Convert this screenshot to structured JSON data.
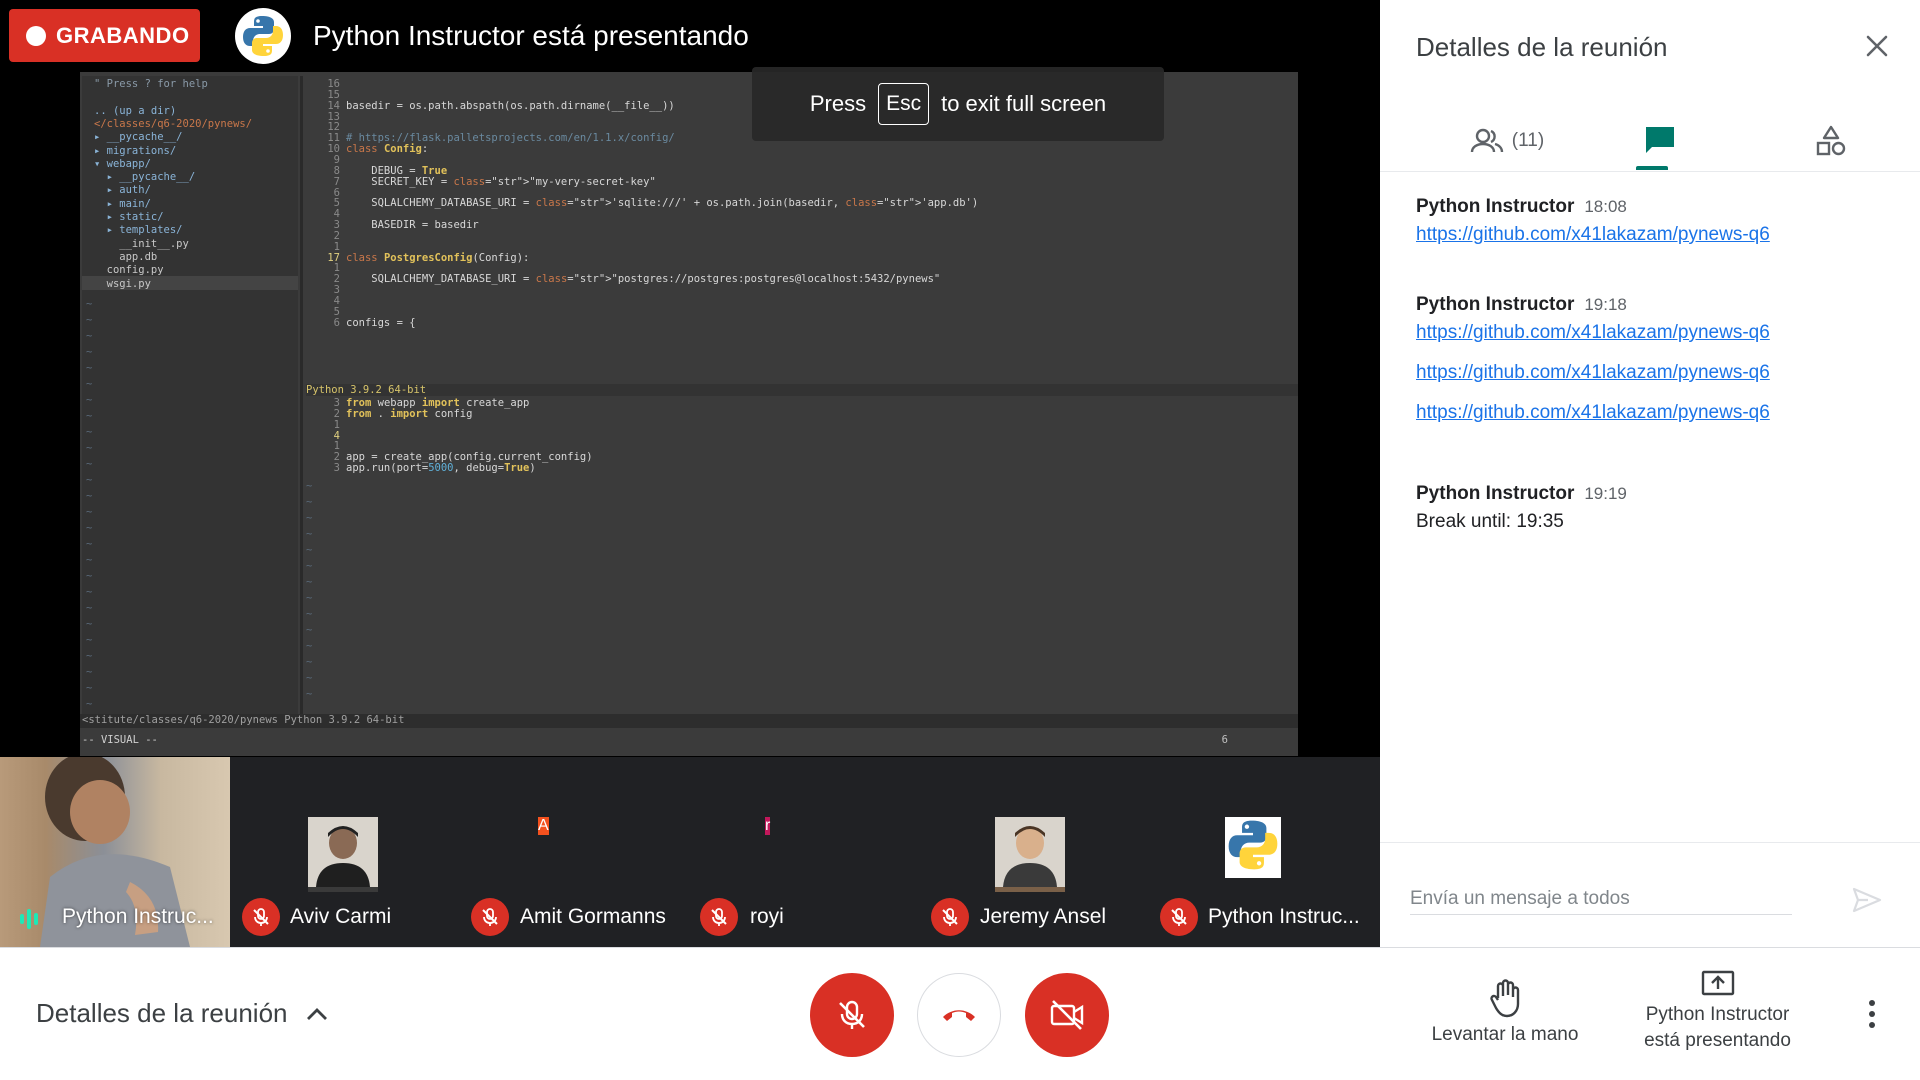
{
  "recording": {
    "label": "GRABANDO"
  },
  "presenter": {
    "title": "Python Instructor está presentando"
  },
  "fullscreen_toast": {
    "before": "Press",
    "key": "Esc",
    "after": "to exit full screen"
  },
  "vim": {
    "tree": [
      "\" Press ? for help",
      "",
      ".. (up a dir)",
      "</classes/q6-2020/pynews/",
      "▸ __pycache__/",
      "▸ migrations/",
      "▾ webapp/",
      "  ▸ __pycache__/",
      "  ▸ auth/",
      "  ▸ main/",
      "  ▸ static/",
      "  ▸ templates/",
      "    __init__.py",
      "    app.db",
      "  config.py",
      "  wsgi.py"
    ],
    "code_top": [
      {
        "n": "16",
        "t": ""
      },
      {
        "n": "15",
        "t": ""
      },
      {
        "n": "14",
        "t": "basedir = os.path.abspath(os.path.dirname(__file__))"
      },
      {
        "n": "13",
        "t": ""
      },
      {
        "n": "12",
        "t": ""
      },
      {
        "n": "11",
        "t": "# https://flask.palletsprojects.com/en/1.1.x/config/"
      },
      {
        "n": "10",
        "t": "class Config:"
      },
      {
        "n": "9",
        "t": ""
      },
      {
        "n": "8",
        "t": "    DEBUG = True"
      },
      {
        "n": "7",
        "t": "    SECRET_KEY = \"my-very-secret-key\""
      },
      {
        "n": "6",
        "t": ""
      },
      {
        "n": "5",
        "t": "    SQLALCHEMY_DATABASE_URI = 'sqlite:///' + os.path.join(basedir, 'app.db')"
      },
      {
        "n": "4",
        "t": ""
      },
      {
        "n": "3",
        "t": "    BASEDIR = basedir"
      },
      {
        "n": "2",
        "t": ""
      },
      {
        "n": "1",
        "t": ""
      },
      {
        "n": "17",
        "t": "class PostgresConfig(Config):"
      },
      {
        "n": "1",
        "t": ""
      },
      {
        "n": "2",
        "t": "    SQLALCHEMY_DATABASE_URI = \"postgres://postgres:postgres@localhost:5432/pynews\""
      },
      {
        "n": "3",
        "t": ""
      },
      {
        "n": "4",
        "t": ""
      },
      {
        "n": "5",
        "t": ""
      },
      {
        "n": "6",
        "t": "configs = {"
      }
    ],
    "python_banner": "Python 3.9.2 64-bit",
    "code_bottom": [
      {
        "n": "3",
        "t": "from webapp import create_app"
      },
      {
        "n": "2",
        "t": "from . import config"
      },
      {
        "n": "1",
        "t": ""
      },
      {
        "n": "4",
        "t": ""
      },
      {
        "n": "1",
        "t": ""
      },
      {
        "n": "2",
        "t": "app = create_app(config.current_config)"
      },
      {
        "n": "3",
        "t": "app.run(port=5000, debug=True)"
      }
    ],
    "status_line": "<stitute/classes/q6-2020/pynews Python 3.9.2 64-bit",
    "mode_line": "-- VISUAL --",
    "mode_count": "6"
  },
  "participants": [
    {
      "name": "Python Instruc...",
      "kind": "camera",
      "speaking": true
    },
    {
      "name": "Aviv Carmi",
      "kind": "photo",
      "muted": true,
      "avatar_color": "#3a3a3a"
    },
    {
      "name": "Amit Gormanns",
      "kind": "initial",
      "initial": "A",
      "muted": true,
      "avatar_color": "#f4511e"
    },
    {
      "name": "royi",
      "kind": "initial",
      "initial": "r",
      "muted": true,
      "avatar_color": "#c2185b"
    },
    {
      "name": "Jeremy Ansel",
      "kind": "photo",
      "muted": true,
      "avatar_color": "#7a6048"
    },
    {
      "name": "Python Instruc...",
      "kind": "python-logo",
      "muted": true,
      "avatar_color": "#ffffff"
    }
  ],
  "panel": {
    "title": "Detalles de la reunión",
    "people_count": "(11)",
    "messages": [
      {
        "who": "Python Instructor",
        "time": "18:08",
        "lines": [
          {
            "type": "link",
            "text": "https://github.com/x41lakazam/pynews-q6"
          }
        ]
      },
      {
        "who": "Python Instructor",
        "time": "19:18",
        "lines": [
          {
            "type": "link",
            "text": "https://github.com/x41lakazam/pynews-q6"
          },
          {
            "type": "link",
            "text": "https://github.com/x41lakazam/pynews-q6"
          },
          {
            "type": "link",
            "text": "https://github.com/x41lakazam/pynews-q6"
          }
        ]
      },
      {
        "who": "Python Instructor",
        "time": "19:19",
        "lines": [
          {
            "type": "text",
            "text": "Break until: 19:35"
          }
        ]
      }
    ],
    "composer_placeholder": "Envía un mensaje a todos"
  },
  "bottom_bar": {
    "details_label": "Detalles de la reunión",
    "raise_hand_label": "Levantar la mano",
    "presenting_label_1": "Python Instructor",
    "presenting_label_2": "está presentando"
  },
  "colors": {
    "red": "#d93025",
    "teal": "#00796b",
    "link": "#1a73e8"
  }
}
